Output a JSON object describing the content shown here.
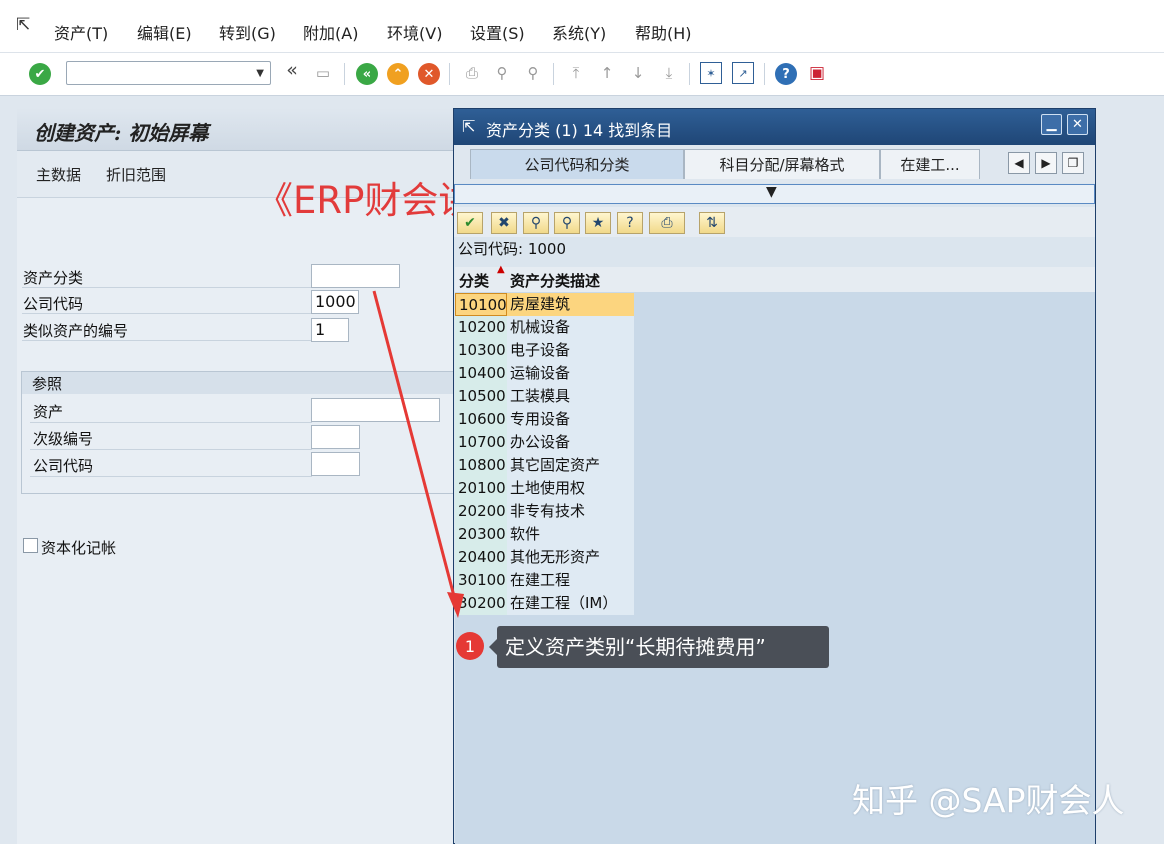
{
  "menu": {
    "items": [
      "资产(T)",
      "编辑(E)",
      "转到(G)",
      "附加(A)",
      "环境(V)",
      "设置(S)",
      "系统(Y)",
      "帮助(H)"
    ]
  },
  "toolbar": {
    "back_symbol": "«",
    "icons": [
      "enter-icon",
      "save-icon",
      "back-icon",
      "exit-icon",
      "cancel-icon",
      "print-icon",
      "find-icon",
      "find-next-icon",
      "first-page-icon",
      "prev-page-icon",
      "next-page-icon",
      "last-page-icon",
      "new-session-icon",
      "shortcut-icon",
      "help-icon",
      "layout-icon"
    ]
  },
  "screen": {
    "title": "创建资产: 初始屏幕",
    "app_buttons": [
      "主数据",
      "折旧范围"
    ],
    "fields": [
      {
        "label": "资产分类",
        "value": ""
      },
      {
        "label": "公司代码",
        "value": "1000"
      },
      {
        "label": "类似资产的编号",
        "value": "1"
      }
    ],
    "reference": {
      "title": "参照",
      "fields": [
        {
          "label": "资产",
          "value": ""
        },
        {
          "label": "次级编号",
          "value": ""
        },
        {
          "label": "公司代码",
          "value": ""
        }
      ]
    },
    "capitalize_label": "资本化记帐"
  },
  "watermark": "《ERP财会讲堂》",
  "dialog": {
    "title": "资产分类 (1)   14 找到条目",
    "tabs": [
      "公司代码和分类",
      "科目分配/屏幕格式",
      "在建工..."
    ],
    "company_line": "公司代码: 1000",
    "columns": [
      "分类",
      "资产分类描述"
    ],
    "rows": [
      {
        "code": "10100",
        "desc": "房屋建筑"
      },
      {
        "code": "10200",
        "desc": "机械设备"
      },
      {
        "code": "10300",
        "desc": "电子设备"
      },
      {
        "code": "10400",
        "desc": "运输设备"
      },
      {
        "code": "10500",
        "desc": "工装模具"
      },
      {
        "code": "10600",
        "desc": "专用设备"
      },
      {
        "code": "10700",
        "desc": "办公设备"
      },
      {
        "code": "10800",
        "desc": "其它固定资产"
      },
      {
        "code": "20100",
        "desc": "土地使用权"
      },
      {
        "code": "20200",
        "desc": "非专有技术"
      },
      {
        "code": "20300",
        "desc": "软件"
      },
      {
        "code": "20400",
        "desc": "其他无形资产"
      },
      {
        "code": "30100",
        "desc": "在建工程"
      },
      {
        "code": "30200",
        "desc": "在建工程（IM）"
      }
    ]
  },
  "callout": {
    "number": "1",
    "text": "定义资产类别“长期待摊费用”"
  },
  "footer_watermark": "知乎 @SAP财会人",
  "colors": {
    "accent": "#e53935",
    "dialog_title": "#1f4676",
    "selected_row": "#fcd57f"
  }
}
